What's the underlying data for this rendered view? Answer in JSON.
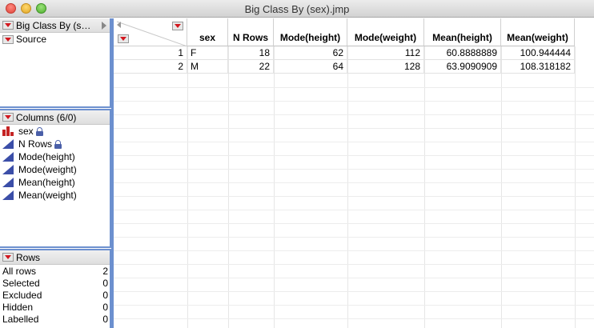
{
  "window": {
    "title": "Big Class By (sex).jmp"
  },
  "left": {
    "table_panel": {
      "title": "Big Class By (s…",
      "items": [
        "Source"
      ]
    },
    "columns_panel": {
      "title": "Columns (6/0)",
      "items": [
        {
          "label": "sex",
          "type": "nominal-icon",
          "locked": true
        },
        {
          "label": "N Rows",
          "type": "continuous-icon",
          "locked": true
        },
        {
          "label": "Mode(height)",
          "type": "continuous-icon",
          "locked": false
        },
        {
          "label": "Mode(weight)",
          "type": "continuous-icon",
          "locked": false
        },
        {
          "label": "Mean(height)",
          "type": "continuous-icon",
          "locked": false
        },
        {
          "label": "Mean(weight)",
          "type": "continuous-icon",
          "locked": false
        }
      ]
    },
    "rows_panel": {
      "title": "Rows",
      "items": [
        {
          "label": "All rows",
          "value": "2"
        },
        {
          "label": "Selected",
          "value": "0"
        },
        {
          "label": "Excluded",
          "value": "0"
        },
        {
          "label": "Hidden",
          "value": "0"
        },
        {
          "label": "Labelled",
          "value": "0"
        }
      ]
    }
  },
  "table": {
    "headers": [
      "sex",
      "N Rows",
      "Mode(height)",
      "Mode(weight)",
      "Mean(height)",
      "Mean(weight)"
    ],
    "rows": [
      {
        "num": "1",
        "cells": [
          "F",
          "18",
          "62",
          "112",
          "60.8888889",
          "100.944444"
        ]
      },
      {
        "num": "2",
        "cells": [
          "M",
          "22",
          "64",
          "128",
          "63.9090909",
          "108.318182"
        ]
      }
    ]
  },
  "colors": {
    "panel_border": "#6c90cf",
    "red_triangle": "#d2181f",
    "continuous_icon": "#3b4ea8",
    "nominal_icon": "#c52424"
  }
}
